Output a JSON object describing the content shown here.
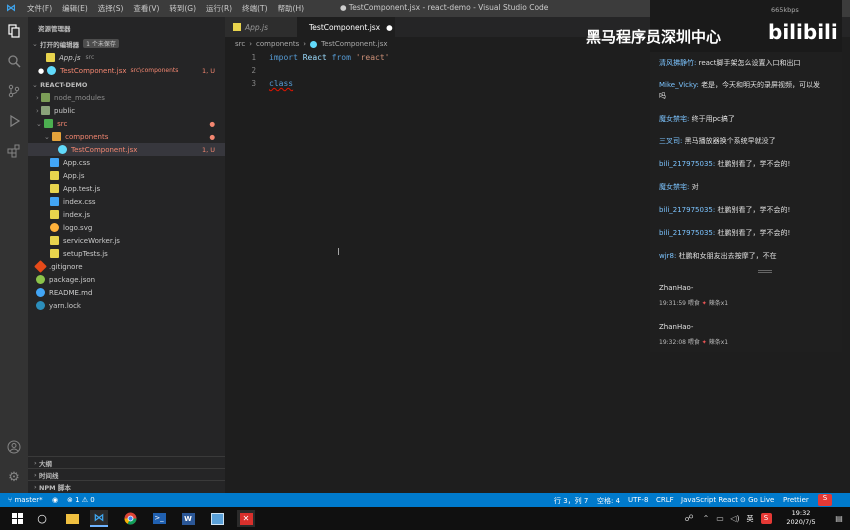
{
  "titlebar": {
    "menu": [
      "文件(F)",
      "编辑(E)",
      "选择(S)",
      "查看(V)",
      "转到(G)",
      "运行(R)",
      "终端(T)",
      "帮助(H)"
    ],
    "title": "● TestComponent.jsx - react-demo - Visual Studio Code"
  },
  "sidebar": {
    "explorer_title": "资源管理器",
    "open_editors": {
      "label": "打开的编辑器",
      "badge": "1 个未保存"
    },
    "open_files": [
      {
        "name": "App.js",
        "path": "src"
      },
      {
        "name": "TestComponent.jsx",
        "path": "src\\components",
        "status": "1, U"
      }
    ],
    "project": "REACT-DEMO",
    "tree": [
      {
        "name": "node_modules",
        "type": "folder",
        "indent": 0
      },
      {
        "name": "public",
        "type": "folder",
        "indent": 0
      },
      {
        "name": "src",
        "type": "folder",
        "indent": 0
      },
      {
        "name": "components",
        "type": "folder",
        "indent": 1
      },
      {
        "name": "TestComponent.jsx",
        "type": "file",
        "indent": 2,
        "status": "1, U"
      },
      {
        "name": "App.css",
        "type": "file",
        "indent": 1
      },
      {
        "name": "App.js",
        "type": "file",
        "indent": 1
      },
      {
        "name": "App.test.js",
        "type": "file",
        "indent": 1
      },
      {
        "name": "index.css",
        "type": "file",
        "indent": 1
      },
      {
        "name": "index.js",
        "type": "file",
        "indent": 1
      },
      {
        "name": "logo.svg",
        "type": "file",
        "indent": 1
      },
      {
        "name": "serviceWorker.js",
        "type": "file",
        "indent": 1
      },
      {
        "name": "setupTests.js",
        "type": "file",
        "indent": 1
      },
      {
        "name": ".gitignore",
        "type": "file",
        "indent": 0
      },
      {
        "name": "package.json",
        "type": "file",
        "indent": 0
      },
      {
        "name": "README.md",
        "type": "file",
        "indent": 0
      },
      {
        "name": "yarn.lock",
        "type": "file",
        "indent": 0
      }
    ],
    "panels": [
      "大纲",
      "时间线",
      "NPM 脚本"
    ]
  },
  "tabs": [
    {
      "label": "App.js"
    },
    {
      "label": "TestComponent.jsx",
      "active": true
    }
  ],
  "breadcrumb": [
    "src",
    "components",
    "TestComponent.jsx"
  ],
  "editor": {
    "line1": {
      "num": "1",
      "kw1": "import",
      "id": "React",
      "kw2": "from",
      "str": "'react'"
    },
    "line2": {
      "num": "2"
    },
    "line3": {
      "num": "3",
      "kw": "class"
    }
  },
  "overlay": {
    "watermark": "黑马程序员深圳中心",
    "bili": "bilibili",
    "chat": [
      {
        "name": "清风拂静竹:",
        "text": "react脚手架怎么设置入口和出口"
      },
      {
        "name": "Mike_Vicky:",
        "text": "老是，今天和明天的录屏视频，可以发"
      },
      {
        "name": "",
        "text": "吗"
      },
      {
        "name": "魔女禁宅:",
        "text": "终于用pc搞了"
      },
      {
        "name": "三叉司:",
        "text": "黑马播放器换个系统早就没了"
      },
      {
        "name": "bili_217975035:",
        "text": "杜鹏别看了，学不会的!"
      },
      {
        "name": "魔女禁宅:",
        "text": "对"
      },
      {
        "name": "bili_217975035:",
        "text": "杜鹏别看了，学不会的!"
      },
      {
        "name": "bili_217975035:",
        "text": "杜鹏别看了，学不会的!"
      },
      {
        "name": "wjr8:",
        "text": "杜鹏和女朋友出去按摩了，不在"
      }
    ],
    "gifts": [
      {
        "user": "ZhanHao-",
        "time": "19:31:59 喂食",
        "item": "辣条x1"
      },
      {
        "user": "ZhanHao-",
        "time": "19:32:08 喂食",
        "item": "辣条x1"
      }
    ],
    "stat": "665kbps"
  },
  "statusbar": {
    "branch": "master*",
    "errors": "⊗ 1 ⚠ 0",
    "position": "行 3，列 7",
    "spaces": "空格: 4",
    "encoding": "UTF-8",
    "eol": "CRLF",
    "language": "JavaScript React",
    "golive": "Go Live",
    "prettier": "Prettier"
  },
  "taskbar": {
    "ime": "英",
    "time": "19:32",
    "date": "2020/7/5"
  }
}
